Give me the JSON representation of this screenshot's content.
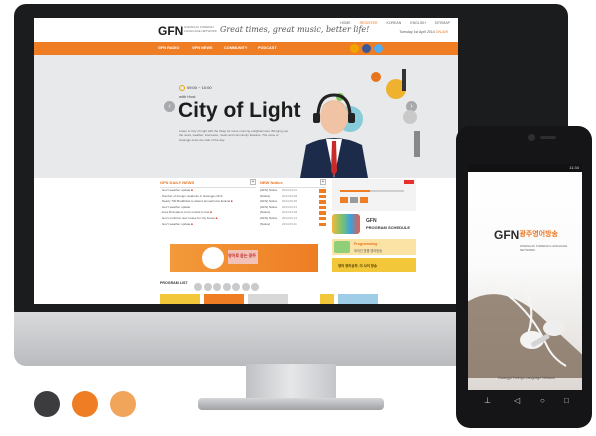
{
  "header": {
    "logo": "GFN",
    "logo_sub": "GWANGJU FOREIGN LANGUAGE NETWORK",
    "slogan": "Great times, great music, better life!",
    "top_links": [
      "HOME",
      "REGISTER",
      "KOREAN",
      "ENGLISH",
      "SITEMAP"
    ],
    "date": "Tuesday 1st April 2014",
    "date_accent": "ON-AIR"
  },
  "nav": {
    "items": [
      "GFN RADIO",
      "GFN NEWS",
      "COMMUNITY",
      "PODCAST"
    ],
    "social_colors": [
      "#f0a400",
      "#3b5998",
      "#55acee"
    ]
  },
  "hero": {
    "on_air": "09:00 ~ 10:00",
    "host": "with Host",
    "title": "City of Light",
    "description": "Listen to City of Light with the Okay for some morning enlightenment. Bringing you the news, weather, interviews, music and community features. The voice of Gwangju since the start of the day."
  },
  "news": {
    "title": "GFN DAILY NEWS",
    "items": [
      "Gov't weather update",
      "Number of foreign residents in Gwangju climb",
      "Nearly 700 Buddhists to attend annual lotus festival",
      "Gov't weather update",
      "Area filmmakers to be invited to fest",
      "Gov't confirms new routes for city buses",
      "Gov't weather update"
    ]
  },
  "notice": {
    "title": "NEW Notice",
    "rows": [
      {
        "label": "[GFN] Notice",
        "date": "2014.04.01"
      },
      {
        "label": "[Notice]",
        "date": "2014.03.28"
      },
      {
        "label": "[GFN] Notice",
        "date": "2014.03.25"
      },
      {
        "label": "[GFN] Notice",
        "date": "2014.03.21"
      },
      {
        "label": "[Notice]",
        "date": "2014.03.18"
      },
      {
        "label": "[GFN] Notice",
        "date": "2014.03.14"
      },
      {
        "label": "[Notice]",
        "date": "2014.03.11"
      }
    ]
  },
  "schedule": {
    "logo": "GFN",
    "label": "PROGRAM SCHEDULE"
  },
  "banners": {
    "main": "영어로 듣는 광주",
    "side_top": "Programming",
    "side_sub": "외국인 맞춤 영어방송",
    "side_bottom": "영어 영어공부, 이 사이 방송"
  },
  "program": {
    "label": "PROGRAM LIST",
    "tile_colors": [
      "#f3c73a",
      "#ee7d24",
      "#d8d8d8",
      "#f3c73a",
      "#9fcde8"
    ]
  },
  "phone": {
    "status": "11:34",
    "logo": "GFN",
    "logo_kr": "광주영어방송",
    "sub": "GWANGJU FOREIGN LANGUAGE NETWORK",
    "tagline": "Gwangju Foreign Language Network"
  },
  "swatches": [
    "#3c3c3e",
    "#ee7d24",
    "#f0a55a"
  ]
}
